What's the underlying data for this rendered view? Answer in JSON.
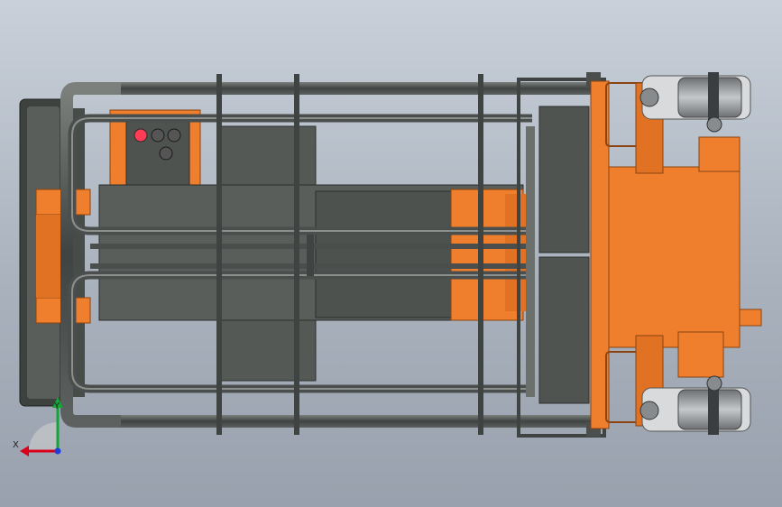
{
  "colors": {
    "background_top": "#c9d0da",
    "background_bottom": "#98a1ad",
    "frame_orange": "#f07f2d",
    "frame_orange_dark": "#c35e18",
    "rail_dark": "#4d514f",
    "rail_highlight": "#8a8f8c",
    "panel_dark": "#555955",
    "wheel_grey": "#8c8f92",
    "indicator_red": "#ff3c55",
    "axis_x": "#d9001b",
    "axis_y": "#13a538",
    "axis_z": "#1f3fd6"
  },
  "control_panel": {
    "indicators": [
      "red-light",
      "black-light",
      "black-light",
      "black-light"
    ]
  },
  "axis_triad": {
    "x_label": "X",
    "y_label": "Y"
  }
}
